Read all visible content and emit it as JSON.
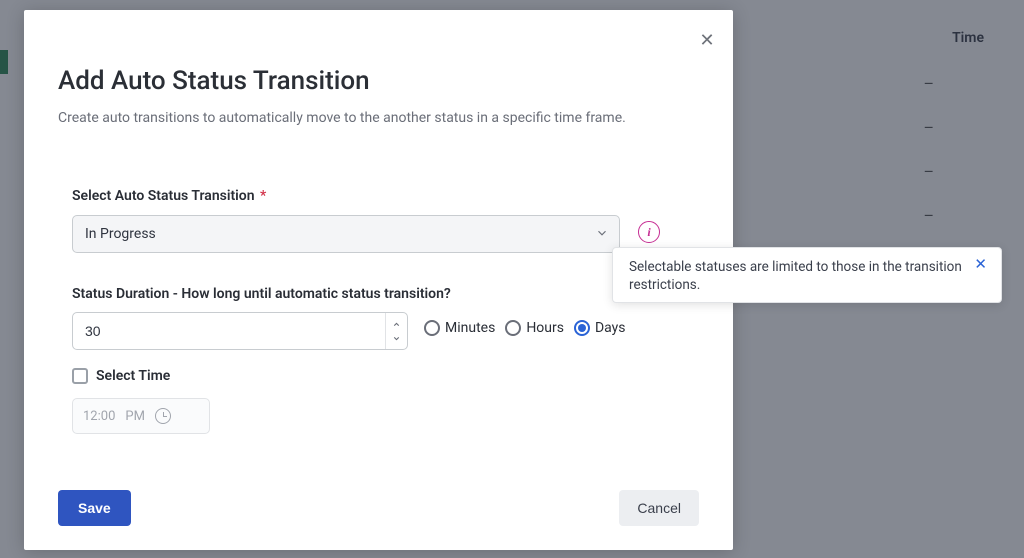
{
  "background": {
    "time_header": "Time",
    "dashes": [
      "–",
      "–",
      "–",
      "–"
    ]
  },
  "modal": {
    "title": "Add Auto Status Transition",
    "subtitle": "Create auto transitions to automatically move to the another status in a specific time frame.",
    "close_sym": "✕",
    "select_label": "Select Auto Status Transition",
    "required": "*",
    "select_value": "In Progress",
    "info_sym": "i",
    "duration_label": "Status Duration - How long until automatic status transition?",
    "duration_value": "30",
    "units": {
      "minutes": "Minutes",
      "hours": "Hours",
      "days": "Days",
      "selected": "days"
    },
    "select_time_label": "Select Time",
    "select_time_checked": false,
    "time_value": "12:00",
    "time_meridiem": "PM",
    "save_label": "Save",
    "cancel_label": "Cancel"
  },
  "tooltip": {
    "text": "Selectable statuses are limited to those in the transition restrictions.",
    "close_sym": "✕"
  }
}
